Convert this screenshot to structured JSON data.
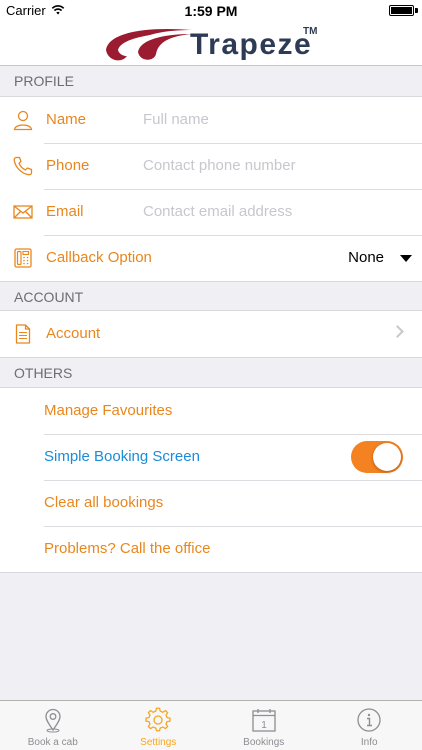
{
  "status_bar": {
    "carrier": "Carrier",
    "time": "1:59 PM"
  },
  "header": {
    "logo_text": "Trapeze",
    "trademark": "TM"
  },
  "sections": {
    "profile": "PROFILE",
    "account": "ACCOUNT",
    "others": "OTHERS"
  },
  "profile": {
    "name_label": "Name",
    "name_placeholder": "Full name",
    "phone_label": "Phone",
    "phone_placeholder": "Contact phone number",
    "email_label": "Email",
    "email_placeholder": "Contact email address",
    "callback_label": "Callback Option",
    "callback_value": "None"
  },
  "account": {
    "account_label": "Account"
  },
  "others": {
    "manage_favourites": "Manage Favourites",
    "simple_booking_screen": "Simple Booking Screen",
    "simple_booking_enabled": true,
    "clear_all_bookings": "Clear all bookings",
    "call_office": "Problems? Call the office"
  },
  "tabs": [
    {
      "label": "Book a cab",
      "icon": "location-pin-icon",
      "active": false
    },
    {
      "label": "Settings",
      "icon": "gear-icon",
      "active": true
    },
    {
      "label": "Bookings",
      "icon": "calendar-icon",
      "active": false,
      "badge": "1"
    },
    {
      "label": "Info",
      "icon": "info-icon",
      "active": false
    }
  ],
  "colors": {
    "accent": "#e8871e",
    "link_blue": "#1a8cd8",
    "toggle_on": "#f58220",
    "logo_red": "#9b1b30",
    "logo_navy": "#2e3b54"
  }
}
